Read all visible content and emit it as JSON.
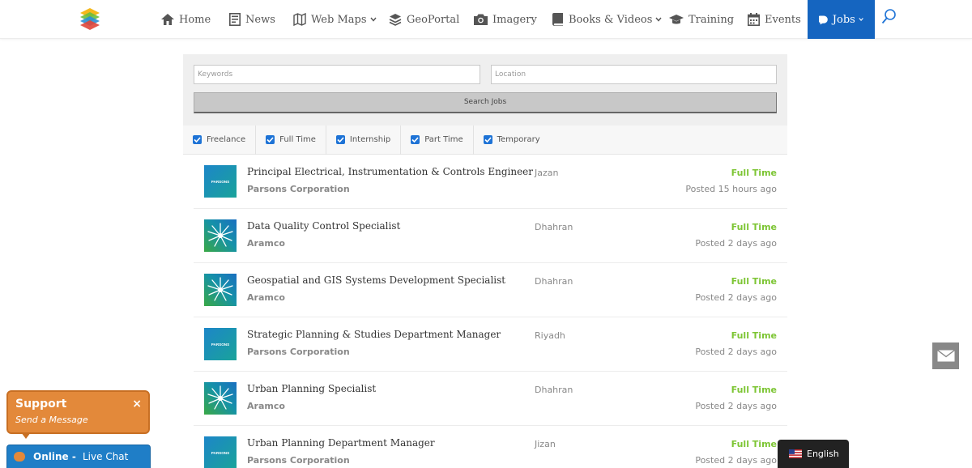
{
  "nav": {
    "home": "Home",
    "news": "News",
    "web_maps": "Web Maps",
    "geoportal": "GeoPortal",
    "imagery": "Imagery",
    "books_videos": "Books & Videos",
    "training": "Training",
    "events": "Events",
    "jobs": "Jobs",
    "active": "jobs",
    "active_color": "#1565c0"
  },
  "search": {
    "keywords_placeholder": "Keywords",
    "location_placeholder": "Location",
    "button_label": "Search Jobs"
  },
  "filters": [
    {
      "label": "Freelance",
      "checked": true
    },
    {
      "label": "Full Time",
      "checked": true
    },
    {
      "label": "Internship",
      "checked": true
    },
    {
      "label": "Part Time",
      "checked": true
    },
    {
      "label": "Temporary",
      "checked": true
    }
  ],
  "jobs": [
    {
      "title": "Principal Electrical, Instrumentation & Controls Engineer",
      "company": "Parsons Corporation",
      "logo": "parsons-logo",
      "location": "Jazan",
      "type": "Full Time",
      "posted": "Posted 15 hours ago"
    },
    {
      "title": "Data Quality Control Specialist",
      "company": "Aramco",
      "logo": "aramco-logo",
      "location": "Dhahran",
      "type": "Full Time",
      "posted": "Posted 2 days ago"
    },
    {
      "title": "Geospatial and GIS Systems Development Specialist",
      "company": "Aramco",
      "logo": "aramco-logo",
      "location": "Dhahran",
      "type": "Full Time",
      "posted": "Posted 2 days ago"
    },
    {
      "title": "Strategic Planning & Studies Department Manager",
      "company": "Parsons Corporation",
      "logo": "parsons-logo",
      "location": "Riyadh",
      "type": "Full Time",
      "posted": "Posted 2 days ago"
    },
    {
      "title": "Urban Planning Specialist",
      "company": "Aramco",
      "logo": "aramco-logo",
      "location": "Dhahran",
      "type": "Full Time",
      "posted": "Posted 2 days ago"
    },
    {
      "title": "Urban Planning Department Manager",
      "company": "Parsons Corporation",
      "logo": "parsons-logo",
      "location": "Jizan",
      "type": "Full Time",
      "posted": "Posted 2 days ago"
    }
  ],
  "parsons_logo_text": "PARSONS",
  "job_type_color": "#7dc534",
  "support": {
    "title": "Support",
    "subtitle": "Send a Message",
    "close": "×"
  },
  "livechat": {
    "status": "Online",
    "separator": " - ",
    "label": "Live Chat"
  },
  "language": {
    "label": "English",
    "flag": "us-flag-icon"
  }
}
